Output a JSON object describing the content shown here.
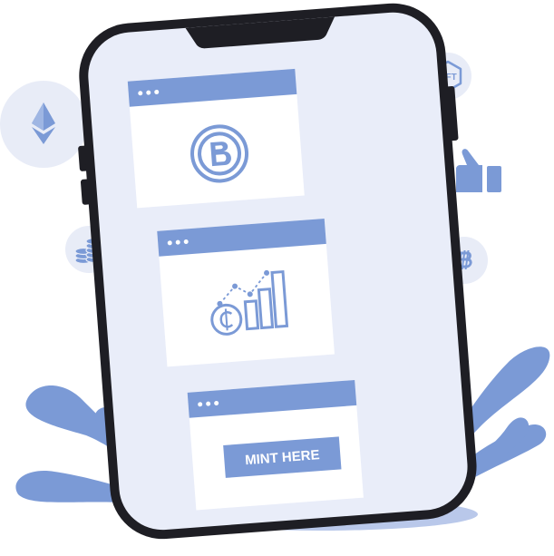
{
  "colors": {
    "accent": "#7b9ad6",
    "accent_light": "#e8ecf7",
    "screen_bg": "#e9edf9",
    "card_bg": "#ffffff",
    "phone_frame": "#1e1e24",
    "foliage": "#7b9ad6",
    "shadow": "#b9c8ea"
  },
  "icons": {
    "floating": [
      "ethereum-icon",
      "nft-icon",
      "coins-stack-icon",
      "thumbs-up-icon",
      "bitcoin-icon"
    ],
    "cards": [
      "b-coin-logo-icon",
      "crypto-growth-chart-icon"
    ]
  },
  "nft_badge": {
    "label": "NFT"
  },
  "cards": [
    {
      "id": "logo-card",
      "icon": "b-coin-logo-icon"
    },
    {
      "id": "growth-card",
      "icon": "crypto-growth-chart-icon"
    },
    {
      "id": "mint-card",
      "button_label": "MINT HERE"
    }
  ]
}
